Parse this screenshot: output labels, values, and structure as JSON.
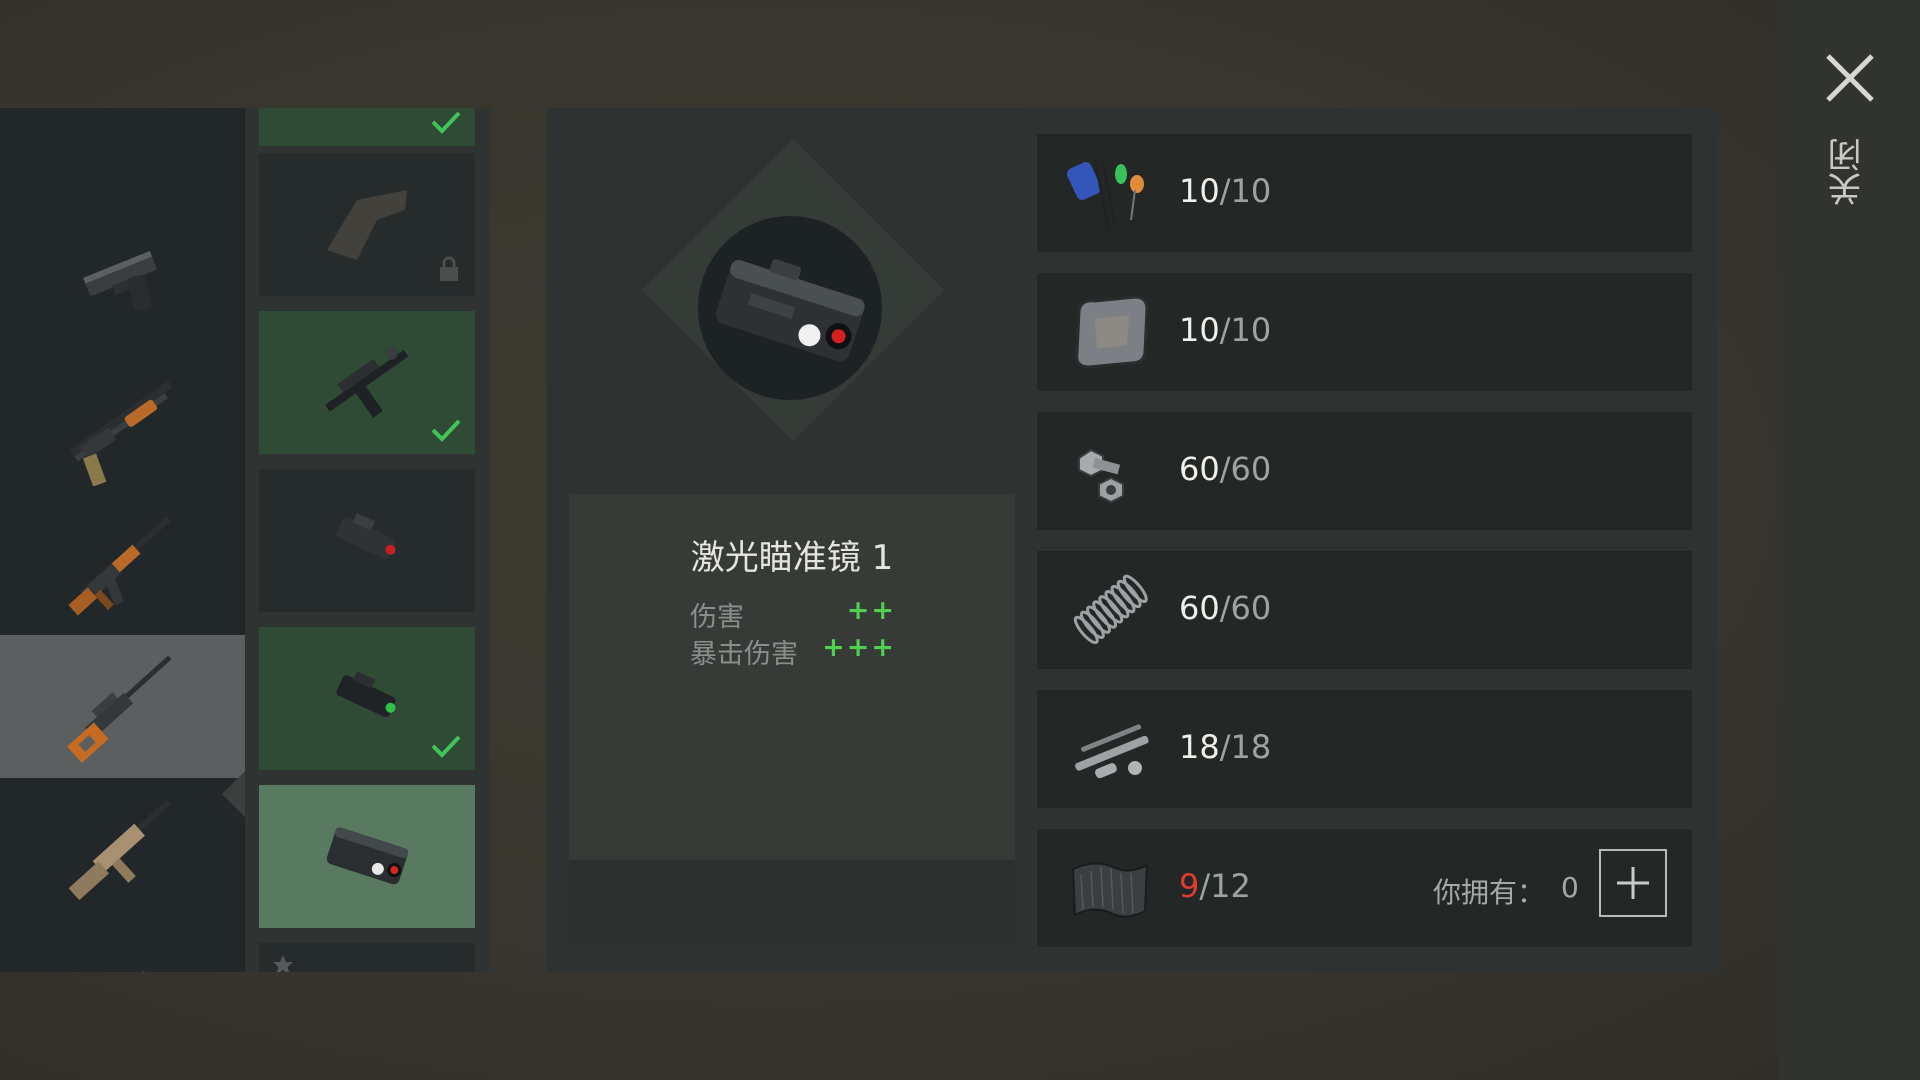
{
  "close": {
    "label": "关闭",
    "icon": "close-icon"
  },
  "weapons": [
    {
      "name": "pistol",
      "icon": "pistol-icon",
      "selected": false
    },
    {
      "name": "shotgun",
      "icon": "shotgun-icon",
      "selected": false
    },
    {
      "name": "ak-rifle",
      "icon": "ak-rifle-icon",
      "selected": false
    },
    {
      "name": "sniper-rifle",
      "icon": "sniper-rifle-icon",
      "selected": true
    },
    {
      "name": "scar-rifle",
      "icon": "scar-rifle-icon",
      "selected": false
    }
  ],
  "attachments": [
    {
      "icon": "grip-icon",
      "state": "locked"
    },
    {
      "icon": "grip-icon",
      "state": "owned"
    },
    {
      "icon": "laser-sight-red-icon",
      "state": "available"
    },
    {
      "icon": "laser-sight-green-icon",
      "state": "owned"
    },
    {
      "icon": "laser-box-icon",
      "state": "current"
    }
  ],
  "item": {
    "name": "激光瞄准镜 1",
    "stats": [
      {
        "label": "伤害",
        "value": "++"
      },
      {
        "label": "暴击伤害",
        "value": "+++"
      }
    ]
  },
  "materials": [
    {
      "icon": "electronic-components-icon",
      "have": "10",
      "need": "/10",
      "short": false
    },
    {
      "icon": "metal-plate-icon",
      "have": "10",
      "need": "/10",
      "short": false
    },
    {
      "icon": "bolt-nut-icon",
      "have": "60",
      "need": "/60",
      "short": false
    },
    {
      "icon": "spring-icon",
      "have": "60",
      "need": "/60",
      "short": false
    },
    {
      "icon": "metal-rods-icon",
      "have": "18",
      "need": "/18",
      "short": false
    },
    {
      "icon": "carbon-fiber-icon",
      "have": "9",
      "need": "/12",
      "short": true,
      "own_label": "你拥有：",
      "own_count": "0"
    }
  ],
  "colors": {
    "short": "#e23c2e",
    "stat_positive": "#4fd04f",
    "check": "#3fc45a"
  }
}
